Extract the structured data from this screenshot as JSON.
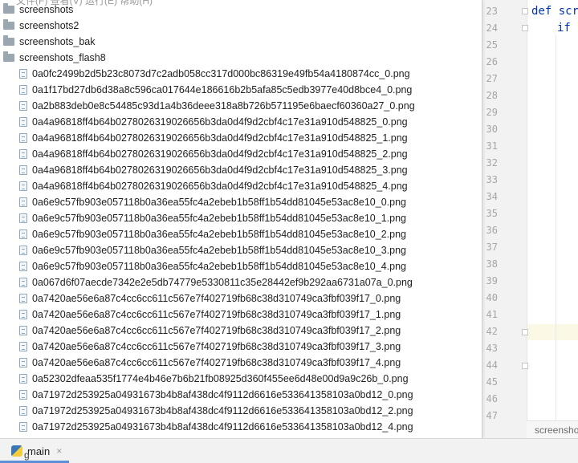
{
  "menu_ghost": "文件(F)    查看(V)    运行(E)    帮助(H)",
  "folders": [
    "screenshots",
    "screenshots2",
    "screenshots_bak",
    "screenshots_flash8"
  ],
  "files": [
    "0a0fc2499b2d5b23c8073d7c2adb058cc317d000bc86319e49fb54a4180874cc_0.png",
    "0a1f17bd27db6d38a8c596ca017644e186616b2b5afa85c5edb3977e40d8bce4_0.png",
    "0a2b883deb0e8c54485c93d1a4b36deee318a8b726b571195e6baecf60360a27_0.png",
    "0a4a96818ff4b64b0278026319026656b3da0d4f9d2cbf4c17e31a910d548825_0.png",
    "0a4a96818ff4b64b0278026319026656b3da0d4f9d2cbf4c17e31a910d548825_1.png",
    "0a4a96818ff4b64b0278026319026656b3da0d4f9d2cbf4c17e31a910d548825_2.png",
    "0a4a96818ff4b64b0278026319026656b3da0d4f9d2cbf4c17e31a910d548825_3.png",
    "0a4a96818ff4b64b0278026319026656b3da0d4f9d2cbf4c17e31a910d548825_4.png",
    "0a6e9c57fb903e057118b0a36ea55fc4a2ebeb1b58ff1b54dd81045e53ac8e10_0.png",
    "0a6e9c57fb903e057118b0a36ea55fc4a2ebeb1b58ff1b54dd81045e53ac8e10_1.png",
    "0a6e9c57fb903e057118b0a36ea55fc4a2ebeb1b58ff1b54dd81045e53ac8e10_2.png",
    "0a6e9c57fb903e057118b0a36ea55fc4a2ebeb1b58ff1b54dd81045e53ac8e10_3.png",
    "0a6e9c57fb903e057118b0a36ea55fc4a2ebeb1b58ff1b54dd81045e53ac8e10_4.png",
    "0a067d6f07aecde7342e2e5db74779e5330811c35e28442ef9b292aa6731a07a_0.png",
    "0a7420ae56e6a87c4cc6cc611c567e7f402719fb68c38d310749ca3fbf039f17_0.png",
    "0a7420ae56e6a87c4cc6cc611c567e7f402719fb68c38d310749ca3fbf039f17_1.png",
    "0a7420ae56e6a87c4cc6cc611c567e7f402719fb68c38d310749ca3fbf039f17_2.png",
    "0a7420ae56e6a87c4cc6cc611c567e7f402719fb68c38d310749ca3fbf039f17_3.png",
    "0a7420ae56e6a87c4cc6cc611c567e7f402719fb68c38d310749ca3fbf039f17_4.png",
    "0a52302dfeaa535f1774e4b46e7b6b21fb08925d360f455ee6d48e00d9a9c26b_0.png",
    "0a71972d253925a04931673b4b8af438dc4f9112d6616e533641358103a0bd12_0.png",
    "0a71972d253925a04931673b4b8af438dc4f9112d6616e533641358103a0bd12_2.png",
    "0a71972d253925a04931673b4b8af438dc4f9112d6616e533641358103a0bd12_4.png"
  ],
  "editor": {
    "line_numbers": [
      "23",
      "24",
      "25",
      "26",
      "27",
      "28",
      "29",
      "30",
      "31",
      "32",
      "33",
      "34",
      "35",
      "36",
      "37",
      "38",
      "39",
      "40",
      "41",
      "42",
      "43",
      "44",
      "45",
      "46",
      "47"
    ],
    "code_line_1": "def scre",
    "code_line_2": "if l",
    "bottom_text": "screensho"
  },
  "run_tab": {
    "label": "main",
    "close": "×"
  },
  "status_ghost": "g",
  "colors": {
    "folder": "#9aa7b0",
    "file_icon": "#8fa5b8",
    "keyword": "#0033b3",
    "tab_underline": "#5c8fd6"
  }
}
